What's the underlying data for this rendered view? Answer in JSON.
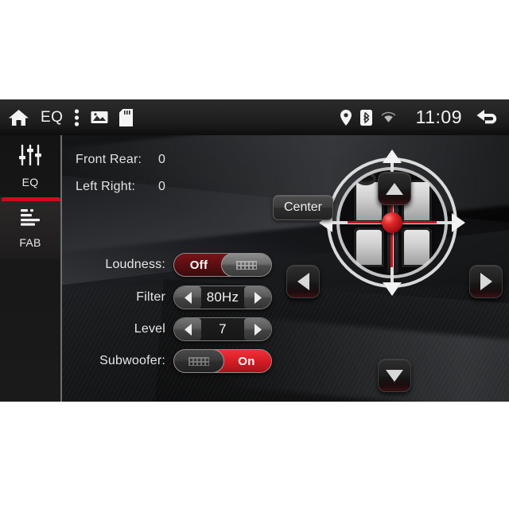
{
  "statusbar": {
    "left_icons": [
      {
        "name": "home-icon",
        "label": "Home"
      },
      {
        "name": "menu-dots-icon",
        "label": "More"
      },
      {
        "name": "gallery-icon",
        "label": "Gallery"
      },
      {
        "name": "sd-card-icon",
        "label": "SD Card"
      }
    ],
    "eq_label": "EQ",
    "right_icons": [
      {
        "name": "location-pin-icon",
        "label": "GPS"
      },
      {
        "name": "bluetooth-icon",
        "label": "Bluetooth"
      },
      {
        "name": "wifi-icon",
        "label": "Wi-Fi"
      }
    ],
    "clock": "11:09",
    "back_label": "Back"
  },
  "sidebar": {
    "items": [
      {
        "label": "EQ",
        "icon": "equalizer-sliders-icon",
        "active": false
      },
      {
        "label": "FAB",
        "icon": "fader-bars-icon",
        "active": true
      }
    ]
  },
  "main": {
    "readouts": [
      {
        "label": "Front Rear:",
        "value": "0"
      },
      {
        "label": "Left Right:",
        "value": "0"
      }
    ],
    "center_button": "Center",
    "controls": [
      {
        "label": "Loudness:",
        "type": "toggle",
        "value": "Off",
        "state": "off"
      },
      {
        "label": "Filter",
        "type": "stepper",
        "value": "80Hz"
      },
      {
        "label": "Level",
        "type": "stepper",
        "value": "7"
      },
      {
        "label": "Subwoofer:",
        "type": "toggle",
        "value": "On",
        "state": "on"
      }
    ],
    "balance": {
      "name": "balance-fader-pad",
      "up": "Front",
      "down": "Rear",
      "left": "Left",
      "right": "Right"
    }
  },
  "colors": {
    "accent_red": "#cf0c1a",
    "toggle_on_red": "#d81f28",
    "toggle_off_red": "#5c0f13",
    "text": "#eaeaea",
    "panel_bg": "#0a0a0a"
  }
}
